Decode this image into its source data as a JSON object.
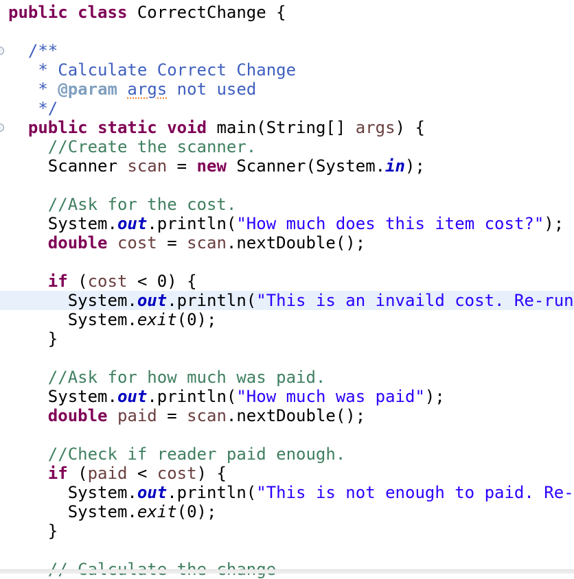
{
  "editor": {
    "highlight_line": 15,
    "fold_lines": [
      2,
      6
    ],
    "colors": {
      "keyword": "#7f0055",
      "javadoc": "#3f5fbf",
      "comment": "#3f7f5f",
      "string": "#2a00ff",
      "field": "#0000c0",
      "local": "#6a3e3e",
      "current_line": "#e8f0fc"
    },
    "lines": [
      [
        [
          "kw",
          "public"
        ],
        [
          "p",
          " "
        ],
        [
          "kw",
          "class"
        ],
        [
          "p",
          " CorrectChange {"
        ]
      ],
      [],
      [
        [
          "p",
          "  "
        ],
        [
          "jd",
          "/**"
        ]
      ],
      [
        [
          "p",
          "   "
        ],
        [
          "jd",
          "* Calculate Correct Change"
        ]
      ],
      [
        [
          "p",
          "   "
        ],
        [
          "jd",
          "* "
        ],
        [
          "jdtag",
          "@param"
        ],
        [
          "jd",
          " "
        ],
        [
          "jdarg",
          "args"
        ],
        [
          "jd",
          " not used"
        ]
      ],
      [
        [
          "p",
          "   "
        ],
        [
          "jd",
          "*/"
        ]
      ],
      [
        [
          "p",
          "  "
        ],
        [
          "kw",
          "public"
        ],
        [
          "p",
          " "
        ],
        [
          "kw",
          "static"
        ],
        [
          "p",
          " "
        ],
        [
          "kw",
          "void"
        ],
        [
          "p",
          " main(String[] "
        ],
        [
          "var",
          "args"
        ],
        [
          "p",
          ") {"
        ]
      ],
      [
        [
          "p",
          "    "
        ],
        [
          "cm",
          "//Create the scanner."
        ]
      ],
      [
        [
          "p",
          "    Scanner "
        ],
        [
          "var",
          "scan"
        ],
        [
          "p",
          " = "
        ],
        [
          "kw",
          "new"
        ],
        [
          "p",
          " Scanner(System."
        ],
        [
          "fld",
          "in"
        ],
        [
          "p",
          ");"
        ]
      ],
      [],
      [
        [
          "p",
          "    "
        ],
        [
          "cm",
          "//Ask for the cost."
        ]
      ],
      [
        [
          "p",
          "    System."
        ],
        [
          "fld",
          "out"
        ],
        [
          "p",
          ".println("
        ],
        [
          "str",
          "\"How much does this item cost?\""
        ],
        [
          "p",
          ");"
        ]
      ],
      [
        [
          "p",
          "    "
        ],
        [
          "kw",
          "double"
        ],
        [
          "p",
          " "
        ],
        [
          "var",
          "cost"
        ],
        [
          "p",
          " = "
        ],
        [
          "var",
          "scan"
        ],
        [
          "p",
          ".nextDouble();"
        ]
      ],
      [],
      [
        [
          "p",
          "    "
        ],
        [
          "kw",
          "if"
        ],
        [
          "p",
          " ("
        ],
        [
          "var",
          "cost"
        ],
        [
          "p",
          " < 0) {"
        ]
      ],
      [
        [
          "p",
          "      System."
        ],
        [
          "fld",
          "out"
        ],
        [
          "p",
          ".println("
        ],
        [
          "str",
          "\"This is an invaild cost. Re-run"
        ]
      ],
      [
        [
          "p",
          "      System."
        ],
        [
          "stm",
          "exit"
        ],
        [
          "p",
          "(0);"
        ]
      ],
      [
        [
          "p",
          "    }"
        ]
      ],
      [],
      [
        [
          "p",
          "    "
        ],
        [
          "cm",
          "//Ask for how much was paid."
        ]
      ],
      [
        [
          "p",
          "    System."
        ],
        [
          "fld",
          "out"
        ],
        [
          "p",
          ".println("
        ],
        [
          "str",
          "\"How much was paid\""
        ],
        [
          "p",
          ");"
        ]
      ],
      [
        [
          "p",
          "    "
        ],
        [
          "kw",
          "double"
        ],
        [
          "p",
          " "
        ],
        [
          "var",
          "paid"
        ],
        [
          "p",
          " = "
        ],
        [
          "var",
          "scan"
        ],
        [
          "p",
          ".nextDouble();"
        ]
      ],
      [],
      [
        [
          "p",
          "    "
        ],
        [
          "cm",
          "//Check if reader paid enough."
        ]
      ],
      [
        [
          "p",
          "    "
        ],
        [
          "kw",
          "if"
        ],
        [
          "p",
          " ("
        ],
        [
          "var",
          "paid"
        ],
        [
          "p",
          " < "
        ],
        [
          "var",
          "cost"
        ],
        [
          "p",
          ") {"
        ]
      ],
      [
        [
          "p",
          "      System."
        ],
        [
          "fld",
          "out"
        ],
        [
          "p",
          ".println("
        ],
        [
          "str",
          "\"This is not enough to paid. Re-"
        ]
      ],
      [
        [
          "p",
          "      System."
        ],
        [
          "stm",
          "exit"
        ],
        [
          "p",
          "(0);"
        ]
      ],
      [
        [
          "p",
          "    }"
        ]
      ],
      [],
      [
        [
          "p",
          "    "
        ],
        [
          "cm",
          "// Calculate the change"
        ]
      ]
    ]
  }
}
